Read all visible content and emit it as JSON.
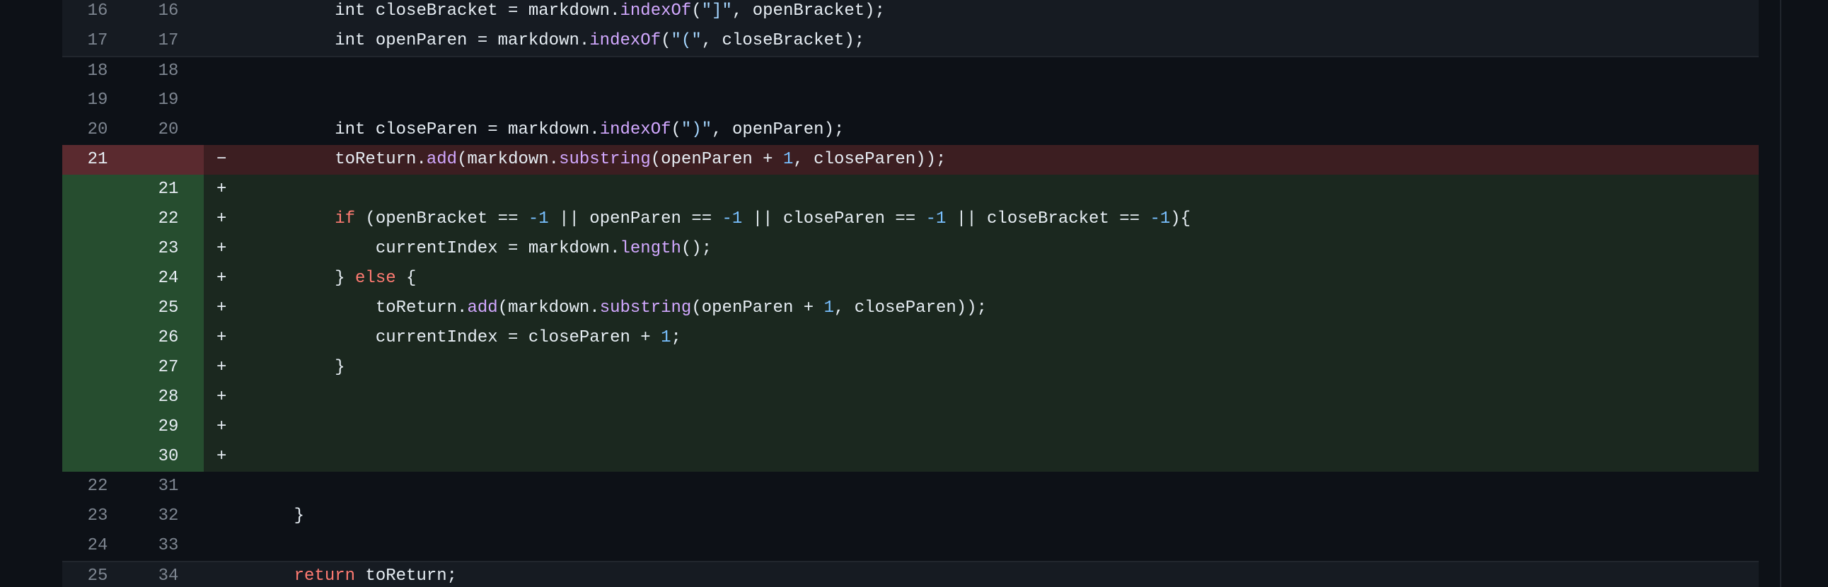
{
  "diff": {
    "rows": [
      {
        "old": "16",
        "new": "16",
        "marker": "",
        "kind": "band",
        "indent": 8,
        "tokens": [
          [
            "plain",
            "int closeBracket = markdown."
          ],
          [
            "fn",
            "indexOf"
          ],
          [
            "plain",
            "("
          ],
          [
            "str",
            "\"]\""
          ],
          [
            "plain",
            ", openBracket);"
          ]
        ]
      },
      {
        "old": "17",
        "new": "17",
        "marker": "",
        "kind": "band",
        "indent": 8,
        "tokens": [
          [
            "plain",
            "int openParen = markdown."
          ],
          [
            "fn",
            "indexOf"
          ],
          [
            "plain",
            "("
          ],
          [
            "str",
            "\"(\""
          ],
          [
            "plain",
            ", closeBracket);"
          ]
        ]
      },
      {
        "old": "18",
        "new": "18",
        "marker": "",
        "kind": "context",
        "indent": 0,
        "tokens": []
      },
      {
        "old": "19",
        "new": "19",
        "marker": "",
        "kind": "context",
        "indent": 0,
        "tokens": []
      },
      {
        "old": "20",
        "new": "20",
        "marker": "",
        "kind": "context",
        "indent": 8,
        "tokens": [
          [
            "plain",
            "int closeParen = markdown."
          ],
          [
            "fn",
            "indexOf"
          ],
          [
            "plain",
            "("
          ],
          [
            "str",
            "\")\""
          ],
          [
            "plain",
            ", openParen);"
          ]
        ]
      },
      {
        "old": "21",
        "new": "",
        "marker": "−",
        "kind": "removed",
        "indent": 8,
        "tokens": [
          [
            "plain",
            "toReturn."
          ],
          [
            "fn",
            "add"
          ],
          [
            "plain",
            "(markdown."
          ],
          [
            "fn",
            "substring"
          ],
          [
            "plain",
            "(openParen + "
          ],
          [
            "numlit",
            "1"
          ],
          [
            "plain",
            ", closeParen));"
          ]
        ]
      },
      {
        "old": "",
        "new": "21",
        "marker": "+",
        "kind": "added",
        "indent": 0,
        "tokens": []
      },
      {
        "old": "",
        "new": "22",
        "marker": "+",
        "kind": "added",
        "indent": 8,
        "tokens": [
          [
            "kw",
            "if"
          ],
          [
            "plain",
            " (openBracket == "
          ],
          [
            "numlit",
            "-1"
          ],
          [
            "plain",
            " || openParen == "
          ],
          [
            "numlit",
            "-1"
          ],
          [
            "plain",
            " || closeParen == "
          ],
          [
            "numlit",
            "-1"
          ],
          [
            "plain",
            " || closeBracket == "
          ],
          [
            "numlit",
            "-1"
          ],
          [
            "plain",
            "){"
          ]
        ]
      },
      {
        "old": "",
        "new": "23",
        "marker": "+",
        "kind": "added",
        "indent": 12,
        "tokens": [
          [
            "plain",
            "currentIndex = markdown."
          ],
          [
            "fn",
            "length"
          ],
          [
            "plain",
            "();"
          ]
        ]
      },
      {
        "old": "",
        "new": "24",
        "marker": "+",
        "kind": "added",
        "indent": 8,
        "tokens": [
          [
            "plain",
            "} "
          ],
          [
            "kw",
            "else"
          ],
          [
            "plain",
            " {"
          ]
        ]
      },
      {
        "old": "",
        "new": "25",
        "marker": "+",
        "kind": "added",
        "indent": 12,
        "tokens": [
          [
            "plain",
            "toReturn."
          ],
          [
            "fn",
            "add"
          ],
          [
            "plain",
            "(markdown."
          ],
          [
            "fn",
            "substring"
          ],
          [
            "plain",
            "(openParen + "
          ],
          [
            "numlit",
            "1"
          ],
          [
            "plain",
            ", closeParen));"
          ]
        ]
      },
      {
        "old": "",
        "new": "26",
        "marker": "+",
        "kind": "added",
        "indent": 12,
        "tokens": [
          [
            "plain",
            "currentIndex = closeParen + "
          ],
          [
            "numlit",
            "1"
          ],
          [
            "plain",
            ";"
          ]
        ]
      },
      {
        "old": "",
        "new": "27",
        "marker": "+",
        "kind": "added",
        "indent": 8,
        "tokens": [
          [
            "plain",
            "}"
          ]
        ]
      },
      {
        "old": "",
        "new": "28",
        "marker": "+",
        "kind": "added",
        "indent": 0,
        "tokens": []
      },
      {
        "old": "",
        "new": "29",
        "marker": "+",
        "kind": "added",
        "indent": 0,
        "tokens": []
      },
      {
        "old": "",
        "new": "30",
        "marker": "+",
        "kind": "added",
        "indent": 0,
        "tokens": []
      },
      {
        "old": "22",
        "new": "31",
        "marker": "",
        "kind": "context",
        "indent": 0,
        "tokens": []
      },
      {
        "old": "23",
        "new": "32",
        "marker": "",
        "kind": "context",
        "indent": 4,
        "tokens": [
          [
            "plain",
            "}"
          ]
        ]
      },
      {
        "old": "24",
        "new": "33",
        "marker": "",
        "kind": "context",
        "indent": 0,
        "tokens": []
      },
      {
        "old": "25",
        "new": "34",
        "marker": "",
        "kind": "band",
        "indent": 4,
        "tokens": [
          [
            "kw",
            "return"
          ],
          [
            "plain",
            " toReturn;"
          ]
        ]
      }
    ]
  }
}
